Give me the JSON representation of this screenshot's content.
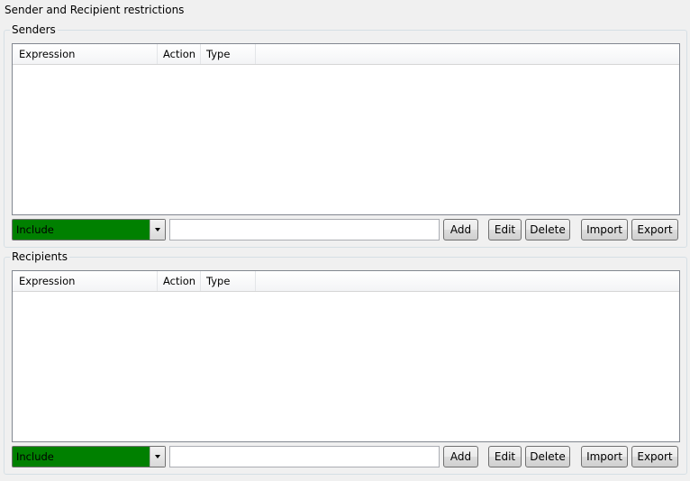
{
  "page": {
    "title": "Sender and Recipient restrictions"
  },
  "colors": {
    "combo_background": "#008000"
  },
  "sections": [
    {
      "legend": "Senders",
      "table": {
        "columns": [
          "Expression",
          "Action",
          "Type"
        ],
        "rows": []
      },
      "combo": {
        "selected": "Include"
      },
      "input": {
        "value": ""
      },
      "buttons": {
        "add": "Add",
        "edit": "Edit",
        "delete": "Delete",
        "import": "Import",
        "export": "Export"
      }
    },
    {
      "legend": "Recipients",
      "table": {
        "columns": [
          "Expression",
          "Action",
          "Type"
        ],
        "rows": []
      },
      "combo": {
        "selected": "Include"
      },
      "input": {
        "value": ""
      },
      "buttons": {
        "add": "Add",
        "edit": "Edit",
        "delete": "Delete",
        "import": "Import",
        "export": "Export"
      }
    }
  ]
}
